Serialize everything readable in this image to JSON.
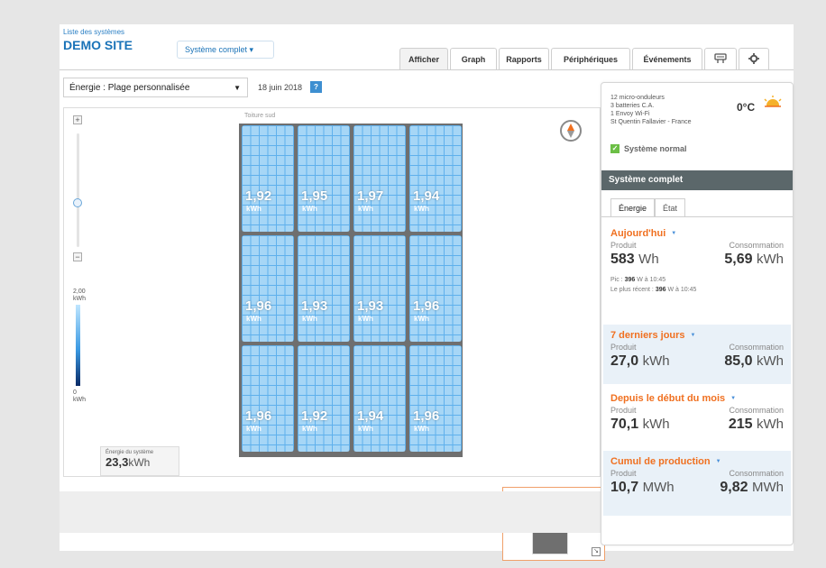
{
  "header": {
    "systems_link": "Liste des systèmes",
    "site_name": "DEMO SITE",
    "system_dropdown": "Système complet ▾"
  },
  "tabs": [
    {
      "label": "Afficher",
      "active": true
    },
    {
      "label": "Graph"
    },
    {
      "label": "Rapports"
    },
    {
      "label": "Périphériques"
    },
    {
      "label": "Événements"
    },
    {
      "label": "",
      "icon": "plug-icon"
    },
    {
      "label": "",
      "icon": "gear-icon"
    }
  ],
  "controls": {
    "energy_select": "Énergie : Plage personnalisée",
    "date": "18 juin 2018"
  },
  "map": {
    "roof_label": "Toiture sud",
    "scale_top_value": "2,00",
    "scale_top_unit": "kWh",
    "scale_bottom_value": "0",
    "scale_bottom_unit": "kWh",
    "panel_unit": "kWh",
    "panels": [
      "1,92",
      "1,95",
      "1,97",
      "1,94",
      "1,96",
      "1,93",
      "1,93",
      "1,96",
      "1,96",
      "1,92",
      "1,94",
      "1,96"
    ],
    "system_energy_label": "Énergie du système",
    "system_energy_value": "23,3",
    "system_energy_unit": "kWh"
  },
  "side": {
    "info_lines": [
      "12 micro-onduleurs",
      "3 batteries C.A.",
      "1 Envoy  Wi-Fi",
      "St Quentin Fallavier - France"
    ],
    "temperature": "0°C",
    "status": "Système normal",
    "header": "Système complet",
    "tabs": [
      "Énergie",
      "État"
    ],
    "today": {
      "title": "Aujourd'hui",
      "produced_label": "Produit",
      "consumed_label": "Consommation",
      "produced_value": "583",
      "produced_unit": "Wh",
      "consumed_value": "5,69",
      "consumed_unit": "kWh",
      "peak_label": "Pic :",
      "peak_value": "396",
      "peak_rest": "W à 10:45",
      "recent_label": "Le plus récent :",
      "recent_value": "396",
      "recent_rest": "W à 10:45"
    },
    "last7": {
      "title": "7 derniers jours",
      "produced_label": "Produit",
      "consumed_label": "Consommation",
      "produced_value": "27,0",
      "produced_unit": "kWh",
      "consumed_value": "85,0",
      "consumed_unit": "kWh"
    },
    "month": {
      "title": "Depuis le début du mois",
      "produced_label": "Produit",
      "consumed_label": "Consommation",
      "produced_value": "70,1",
      "produced_unit": "kWh",
      "consumed_value": "215",
      "consumed_unit": "kWh"
    },
    "lifetime": {
      "title": "Cumul de production",
      "produced_label": "Produit",
      "consumed_label": "Consommation",
      "produced_value": "10,7",
      "produced_unit": "MWh",
      "consumed_value": "9,82",
      "consumed_unit": "MWh"
    }
  }
}
